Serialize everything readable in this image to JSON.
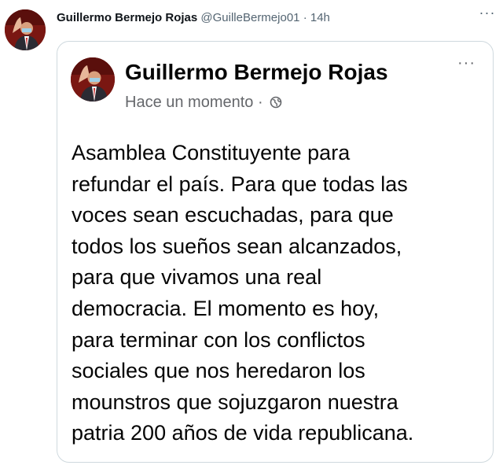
{
  "tweet": {
    "author_name": "Guillermo Bermejo Rojas",
    "author_handle": "@GuilleBermejo01",
    "separator": "·",
    "time": "14h",
    "more_label": "···"
  },
  "embed": {
    "author_name": "Guillermo Bermejo Rojas",
    "timestamp": "Hace un momento",
    "separator": "·",
    "more_label": "···",
    "privacy_icon": "globe-icon",
    "text_lines": [
      "Asamblea Constituyente para",
      "refundar el país. Para que todas las",
      "voces sean escuchadas, para que",
      "todos los sueños sean alcanzados,",
      "para que vivamos una real",
      "democracia. El momento es hoy,",
      "para terminar con los conflictos",
      "sociales que nos heredaron los",
      "mounstros que sojuzgaron nuestra",
      "patria 200 años de vida republicana."
    ]
  },
  "colors": {
    "text_primary": "#0f1419",
    "text_secondary": "#536471",
    "card_border": "#cfd9de",
    "embed_meta": "#65676b"
  }
}
